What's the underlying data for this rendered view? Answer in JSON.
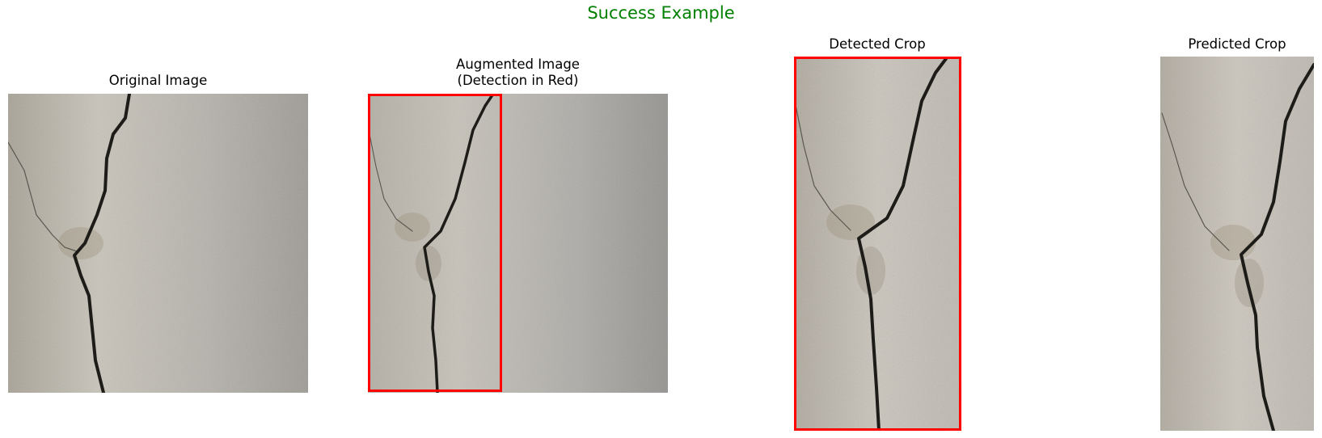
{
  "figure": {
    "title": "Success Example",
    "title_color": "#008000",
    "detection_box_color": "#ff0000"
  },
  "panels": [
    {
      "title_lines": [
        "Original Image"
      ]
    },
    {
      "title_lines": [
        "Augmented Image",
        "(Detection in Red)"
      ]
    },
    {
      "title_lines": [
        "Detected Crop"
      ]
    },
    {
      "title_lines": [
        "Predicted Crop"
      ]
    }
  ]
}
